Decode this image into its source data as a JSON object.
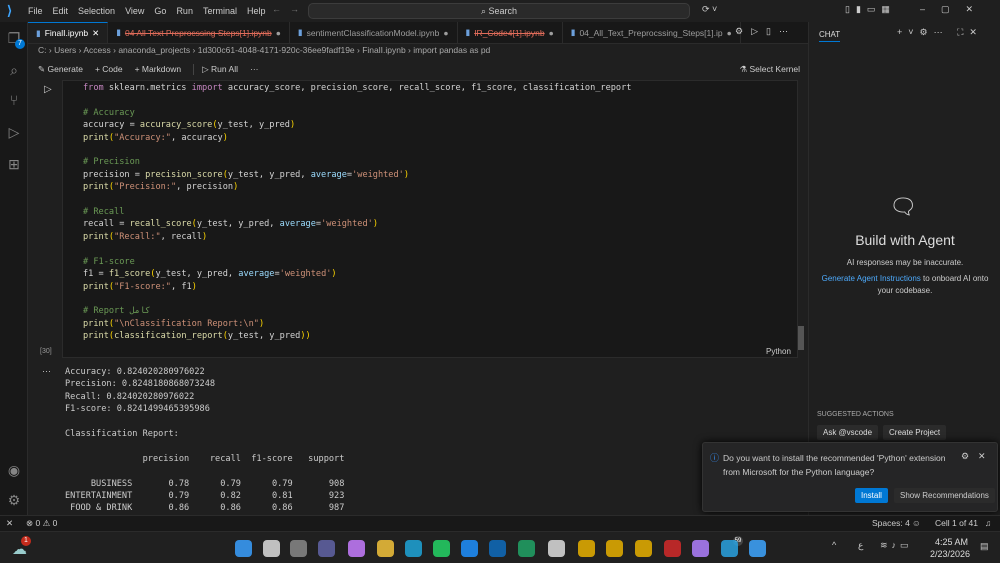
{
  "menu": [
    "File",
    "Edit",
    "Selection",
    "View",
    "Go",
    "Run",
    "Terminal",
    "Help"
  ],
  "search": "Search",
  "tabs": [
    {
      "label": "FinalI.ipynb",
      "active": true,
      "deleted": false
    },
    {
      "label": "04 All Text Preprocssing Steps[1].ipynb",
      "active": false,
      "deleted": true
    },
    {
      "label": "sentimentClassificationModel.ipynb",
      "active": false,
      "deleted": false
    },
    {
      "label": "IR_Code4[1].ipynb",
      "active": false,
      "deleted": true
    },
    {
      "label": "04_All_Text_Preprocssing_Steps[1].ip",
      "active": false,
      "deleted": false
    }
  ],
  "breadcrumb": [
    "C:",
    "Users",
    "Access",
    "anaconda_projects",
    "1d300c61-4048-4171-920c-36ee9fadf19e",
    "FinalI.ipynb",
    "import pandas as pd"
  ],
  "toolbar": {
    "generate": "Generate",
    "code": "Code",
    "markdown": "Markdown",
    "run_all": "Run All",
    "more": "···",
    "kernel": "Select Kernel"
  },
  "activity_badge": "7",
  "cell": {
    "exec_count": "[30]",
    "language": "Python",
    "lines": [
      [
        [
          "kw",
          "from"
        ],
        [
          "tx",
          " sklearn.metrics "
        ],
        [
          "kw",
          "import"
        ],
        [
          "tx",
          " accuracy_score, precision_score, recall_score, f1_score, classification_report"
        ]
      ],
      [],
      [
        [
          "cm",
          "# Accuracy"
        ]
      ],
      [
        [
          "tx",
          "accuracy = "
        ],
        [
          "fn",
          "accuracy_score"
        ],
        [
          "pr",
          "("
        ],
        [
          "tx",
          "y_test, y_pred"
        ],
        [
          "pr",
          ")"
        ]
      ],
      [
        [
          "fn",
          "print"
        ],
        [
          "pr",
          "("
        ],
        [
          "st",
          "\"Accuracy:\""
        ],
        [
          "tx",
          ", accuracy"
        ],
        [
          "pr",
          ")"
        ]
      ],
      [],
      [
        [
          "cm",
          "# Precision"
        ]
      ],
      [
        [
          "tx",
          "precision = "
        ],
        [
          "fn",
          "precision_score"
        ],
        [
          "pr",
          "("
        ],
        [
          "tx",
          "y_test, y_pred, "
        ],
        [
          "pa",
          "average"
        ],
        [
          "tx",
          "="
        ],
        [
          "st",
          "'weighted'"
        ],
        [
          "pr",
          ")"
        ]
      ],
      [
        [
          "fn",
          "print"
        ],
        [
          "pr",
          "("
        ],
        [
          "st",
          "\"Precision:\""
        ],
        [
          "tx",
          ", precision"
        ],
        [
          "pr",
          ")"
        ]
      ],
      [],
      [
        [
          "cm",
          "# Recall"
        ]
      ],
      [
        [
          "tx",
          "recall = "
        ],
        [
          "fn",
          "recall_score"
        ],
        [
          "pr",
          "("
        ],
        [
          "tx",
          "y_test, y_pred, "
        ],
        [
          "pa",
          "average"
        ],
        [
          "tx",
          "="
        ],
        [
          "st",
          "'weighted'"
        ],
        [
          "pr",
          ")"
        ]
      ],
      [
        [
          "fn",
          "print"
        ],
        [
          "pr",
          "("
        ],
        [
          "st",
          "\"Recall:\""
        ],
        [
          "tx",
          ", recall"
        ],
        [
          "pr",
          ")"
        ]
      ],
      [],
      [
        [
          "cm",
          "# F1-score"
        ]
      ],
      [
        [
          "tx",
          "f1 = "
        ],
        [
          "fn",
          "f1_score"
        ],
        [
          "pr",
          "("
        ],
        [
          "tx",
          "y_test, y_pred, "
        ],
        [
          "pa",
          "average"
        ],
        [
          "tx",
          "="
        ],
        [
          "st",
          "'weighted'"
        ],
        [
          "pr",
          ")"
        ]
      ],
      [
        [
          "fn",
          "print"
        ],
        [
          "pr",
          "("
        ],
        [
          "st",
          "\"F1-score:\""
        ],
        [
          "tx",
          ", f1"
        ],
        [
          "pr",
          ")"
        ]
      ],
      [],
      [
        [
          "cm",
          "# Report كامل"
        ]
      ],
      [
        [
          "fn",
          "print"
        ],
        [
          "pr",
          "("
        ],
        [
          "st",
          "\"\\nClassification Report:\\n\""
        ],
        [
          "pr",
          ")"
        ]
      ],
      [
        [
          "fn",
          "print"
        ],
        [
          "pr",
          "("
        ],
        [
          "fn",
          "classification_report"
        ],
        [
          "pr",
          "("
        ],
        [
          "tx",
          "y_test, y_pred"
        ],
        [
          "pr",
          "))"
        ]
      ]
    ]
  },
  "output": [
    "Accuracy: 0.824020280976022",
    "Precision: 0.8248180868073248",
    "Recall: 0.824020280976022",
    "F1-score: 0.8241499465395986",
    "",
    "Classification Report:",
    "",
    "               precision    recall  f1-score   support",
    "",
    "     BUSINESS       0.78      0.79      0.79       908",
    "ENTERTAINMENT       0.79      0.82      0.81       923",
    " FOOD & DRINK       0.86      0.86      0.86       987"
  ],
  "output_ellipsis": "···",
  "chat": {
    "title": "CHAT",
    "heading": "Build with Agent",
    "disclaimer": "AI responses may be inaccurate.",
    "link": "Generate Agent Instructions",
    "link_suffix": " to onboard AI onto your codebase.",
    "suggested": "SUGGESTED ACTIONS",
    "actions": [
      "Ask @vscode",
      "Create Project"
    ]
  },
  "notification": {
    "message": "Do you want to install the recommended 'Python' extension from Microsoft for the Python language?",
    "install": "Install",
    "show": "Show Recommendations"
  },
  "status": {
    "errors": "0",
    "warnings": "0",
    "spaces": "Spaces: 4",
    "cell": "Cell 1 of 41"
  },
  "taskbar": {
    "time": "4:25 AM",
    "date": "2/23/2026",
    "weather_badge": "1",
    "telegram_badge": "59",
    "lang": "ع"
  }
}
